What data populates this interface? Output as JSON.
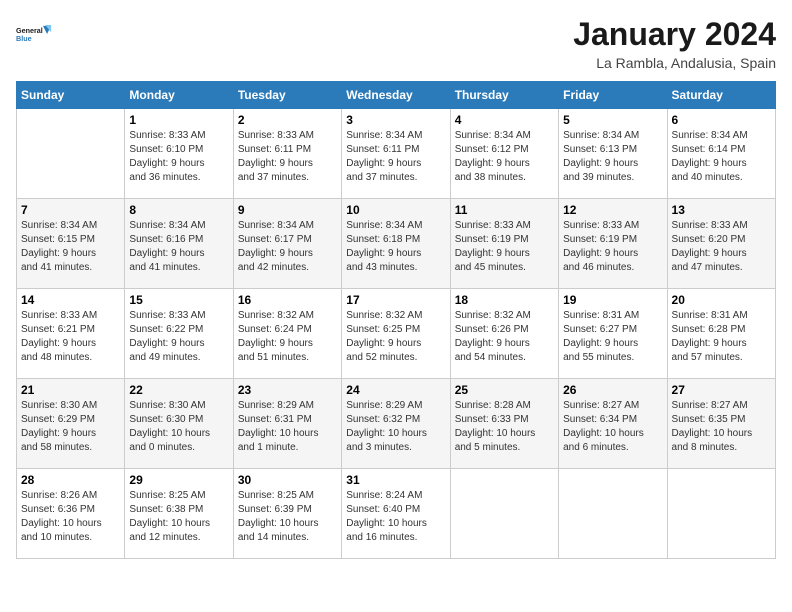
{
  "logo": {
    "line1": "General",
    "line2": "Blue"
  },
  "title": "January 2024",
  "subtitle": "La Rambla, Andalusia, Spain",
  "days_of_week": [
    "Sunday",
    "Monday",
    "Tuesday",
    "Wednesday",
    "Thursday",
    "Friday",
    "Saturday"
  ],
  "weeks": [
    [
      {
        "day": "",
        "info": ""
      },
      {
        "day": "1",
        "info": "Sunrise: 8:33 AM\nSunset: 6:10 PM\nDaylight: 9 hours\nand 36 minutes."
      },
      {
        "day": "2",
        "info": "Sunrise: 8:33 AM\nSunset: 6:11 PM\nDaylight: 9 hours\nand 37 minutes."
      },
      {
        "day": "3",
        "info": "Sunrise: 8:34 AM\nSunset: 6:11 PM\nDaylight: 9 hours\nand 37 minutes."
      },
      {
        "day": "4",
        "info": "Sunrise: 8:34 AM\nSunset: 6:12 PM\nDaylight: 9 hours\nand 38 minutes."
      },
      {
        "day": "5",
        "info": "Sunrise: 8:34 AM\nSunset: 6:13 PM\nDaylight: 9 hours\nand 39 minutes."
      },
      {
        "day": "6",
        "info": "Sunrise: 8:34 AM\nSunset: 6:14 PM\nDaylight: 9 hours\nand 40 minutes."
      }
    ],
    [
      {
        "day": "7",
        "info": "Sunrise: 8:34 AM\nSunset: 6:15 PM\nDaylight: 9 hours\nand 41 minutes."
      },
      {
        "day": "8",
        "info": "Sunrise: 8:34 AM\nSunset: 6:16 PM\nDaylight: 9 hours\nand 41 minutes."
      },
      {
        "day": "9",
        "info": "Sunrise: 8:34 AM\nSunset: 6:17 PM\nDaylight: 9 hours\nand 42 minutes."
      },
      {
        "day": "10",
        "info": "Sunrise: 8:34 AM\nSunset: 6:18 PM\nDaylight: 9 hours\nand 43 minutes."
      },
      {
        "day": "11",
        "info": "Sunrise: 8:33 AM\nSunset: 6:19 PM\nDaylight: 9 hours\nand 45 minutes."
      },
      {
        "day": "12",
        "info": "Sunrise: 8:33 AM\nSunset: 6:19 PM\nDaylight: 9 hours\nand 46 minutes."
      },
      {
        "day": "13",
        "info": "Sunrise: 8:33 AM\nSunset: 6:20 PM\nDaylight: 9 hours\nand 47 minutes."
      }
    ],
    [
      {
        "day": "14",
        "info": "Sunrise: 8:33 AM\nSunset: 6:21 PM\nDaylight: 9 hours\nand 48 minutes."
      },
      {
        "day": "15",
        "info": "Sunrise: 8:33 AM\nSunset: 6:22 PM\nDaylight: 9 hours\nand 49 minutes."
      },
      {
        "day": "16",
        "info": "Sunrise: 8:32 AM\nSunset: 6:24 PM\nDaylight: 9 hours\nand 51 minutes."
      },
      {
        "day": "17",
        "info": "Sunrise: 8:32 AM\nSunset: 6:25 PM\nDaylight: 9 hours\nand 52 minutes."
      },
      {
        "day": "18",
        "info": "Sunrise: 8:32 AM\nSunset: 6:26 PM\nDaylight: 9 hours\nand 54 minutes."
      },
      {
        "day": "19",
        "info": "Sunrise: 8:31 AM\nSunset: 6:27 PM\nDaylight: 9 hours\nand 55 minutes."
      },
      {
        "day": "20",
        "info": "Sunrise: 8:31 AM\nSunset: 6:28 PM\nDaylight: 9 hours\nand 57 minutes."
      }
    ],
    [
      {
        "day": "21",
        "info": "Sunrise: 8:30 AM\nSunset: 6:29 PM\nDaylight: 9 hours\nand 58 minutes."
      },
      {
        "day": "22",
        "info": "Sunrise: 8:30 AM\nSunset: 6:30 PM\nDaylight: 10 hours\nand 0 minutes."
      },
      {
        "day": "23",
        "info": "Sunrise: 8:29 AM\nSunset: 6:31 PM\nDaylight: 10 hours\nand 1 minute."
      },
      {
        "day": "24",
        "info": "Sunrise: 8:29 AM\nSunset: 6:32 PM\nDaylight: 10 hours\nand 3 minutes."
      },
      {
        "day": "25",
        "info": "Sunrise: 8:28 AM\nSunset: 6:33 PM\nDaylight: 10 hours\nand 5 minutes."
      },
      {
        "day": "26",
        "info": "Sunrise: 8:27 AM\nSunset: 6:34 PM\nDaylight: 10 hours\nand 6 minutes."
      },
      {
        "day": "27",
        "info": "Sunrise: 8:27 AM\nSunset: 6:35 PM\nDaylight: 10 hours\nand 8 minutes."
      }
    ],
    [
      {
        "day": "28",
        "info": "Sunrise: 8:26 AM\nSunset: 6:36 PM\nDaylight: 10 hours\nand 10 minutes."
      },
      {
        "day": "29",
        "info": "Sunrise: 8:25 AM\nSunset: 6:38 PM\nDaylight: 10 hours\nand 12 minutes."
      },
      {
        "day": "30",
        "info": "Sunrise: 8:25 AM\nSunset: 6:39 PM\nDaylight: 10 hours\nand 14 minutes."
      },
      {
        "day": "31",
        "info": "Sunrise: 8:24 AM\nSunset: 6:40 PM\nDaylight: 10 hours\nand 16 minutes."
      },
      {
        "day": "",
        "info": ""
      },
      {
        "day": "",
        "info": ""
      },
      {
        "day": "",
        "info": ""
      }
    ]
  ]
}
